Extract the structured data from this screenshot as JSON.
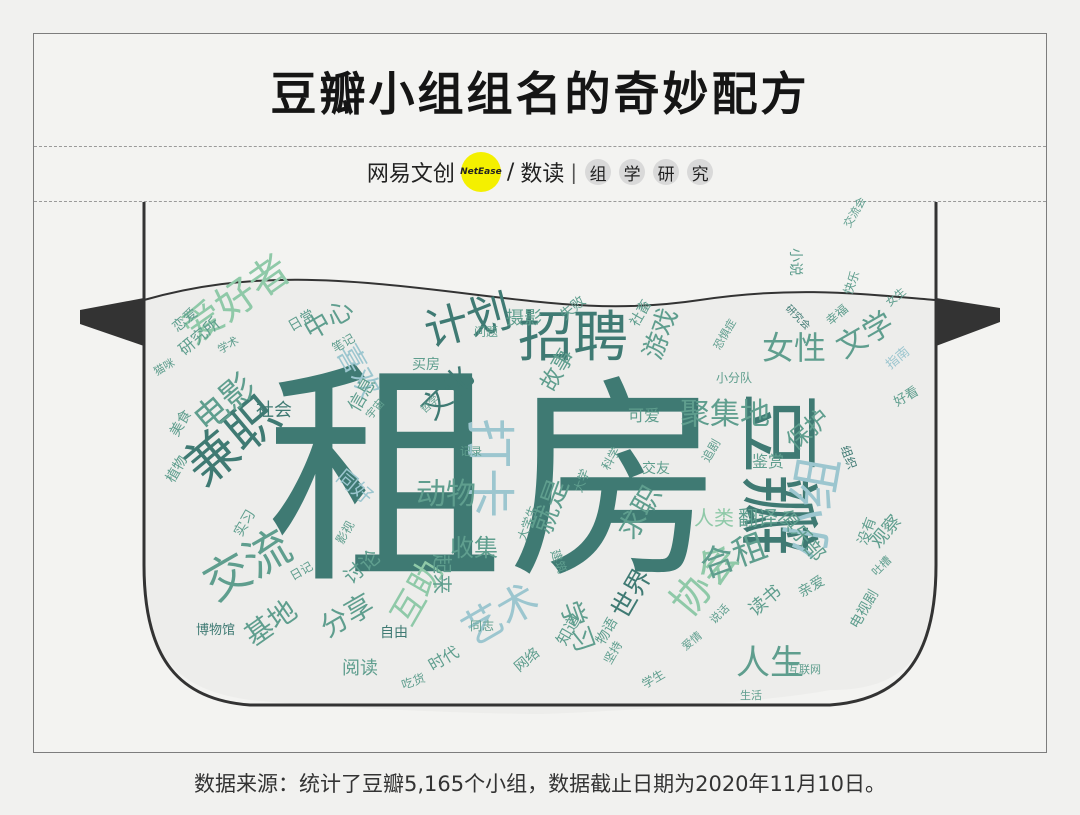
{
  "title": "豆瓣小组组名的奇妙配方",
  "brand": {
    "netease": "网易文创",
    "netease_en": "NetEase",
    "slash": "/",
    "dushu": "数读",
    "divider": "|",
    "study": [
      "组",
      "学",
      "研",
      "究"
    ]
  },
  "footer": "数据来源：统计了豆瓣5,165个小组，数据截止日期为2020年11月10日。",
  "colors": {
    "dark": "#3f7a73",
    "mid": "#5f9e8e",
    "light": "#8fc9a8",
    "blue": "#9cc6cf"
  },
  "words": [
    "租",
    "房",
    "豆瓣",
    "招聘",
    "计划",
    "爱好者",
    "兼职",
    "交流",
    "小组",
    "聚集地",
    "打卡",
    "文化",
    "动物",
    "艺术",
    "互助",
    "协会",
    "合租",
    "人生",
    "女性",
    "文学",
    "电影",
    "喜欢",
    "中心",
    "研究所",
    "基地",
    "分享",
    "学习",
    "世界",
    "读书",
    "游戏",
    "故事",
    "保护",
    "翻译",
    "人类",
    "就是",
    "求职",
    "收集",
    "起来",
    "同好",
    "讨论",
    "信息",
    "社会",
    "摄影",
    "美食",
    "植物",
    "俱乐部",
    "观察",
    "亲爱",
    "阅读",
    "自由",
    "时代",
    "网络",
    "博物馆",
    "实习",
    "买房",
    "恋爱",
    "日常",
    "可爱",
    "交友",
    "鉴赏",
    "失败",
    "社畜",
    "问题",
    "小分队",
    "恐惧症",
    "指南",
    "好看",
    "研究会",
    "组织",
    "没有",
    "电视剧",
    "互联网",
    "大学生",
    "日记",
    "大学",
    "宇宙",
    "哲学",
    "记录",
    "影视",
    "科学",
    "笔记",
    "建筑",
    "追剧",
    "物语",
    "坚持",
    "知道",
    "同志",
    "小说",
    "交流会",
    "快乐",
    "吐槽",
    "说话",
    "幸福",
    "学术",
    "女生",
    "猫咪",
    "爱情",
    "吃货",
    "学生",
    "生活",
    "设计",
    "心理"
  ]
}
